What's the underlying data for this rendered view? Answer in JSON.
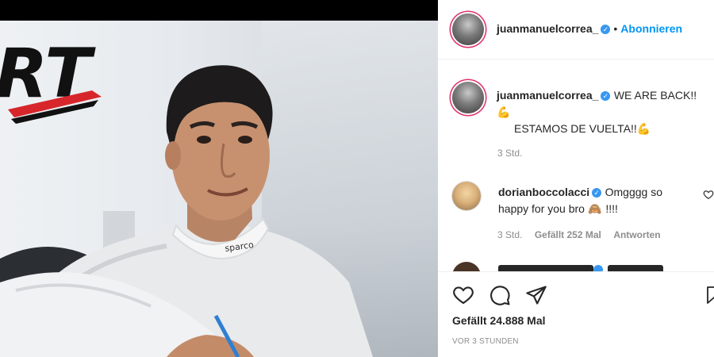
{
  "header": {
    "username": "juanmanuelcorrea_",
    "follow_label": "Abonnieren",
    "separator": "•"
  },
  "caption": {
    "username": "juanmanuelcorrea_",
    "line1": "WE ARE BACK!!",
    "emoji1": "💪",
    "line2": "ESTAMOS DE VUELTA!!",
    "emoji2": "💪",
    "time": "3 Std."
  },
  "comments": [
    {
      "username": "dorianboccolacci",
      "text_line1": "Omgggg so",
      "text_line2": "happy for you bro",
      "emoji": "🙈",
      "text_end": "!!!!",
      "time": "3 Std.",
      "likes": "Gefällt 252 Mal",
      "reply": "Antworten"
    }
  ],
  "actions": {
    "likes": "Gefällt 24.888 Mal",
    "time_ago": "VOR 3 STUNDEN"
  },
  "photo": {
    "logo_text": "RT",
    "suit_brand": "sparco"
  },
  "colors": {
    "accent": "#0095f6",
    "story_ring": "#e1306c",
    "verified": "#3897f0",
    "logo_red": "#d7262b"
  },
  "icons": [
    "heart-icon",
    "comment-icon",
    "share-icon",
    "bookmark-icon",
    "verified-icon",
    "like-comment-icon"
  ]
}
